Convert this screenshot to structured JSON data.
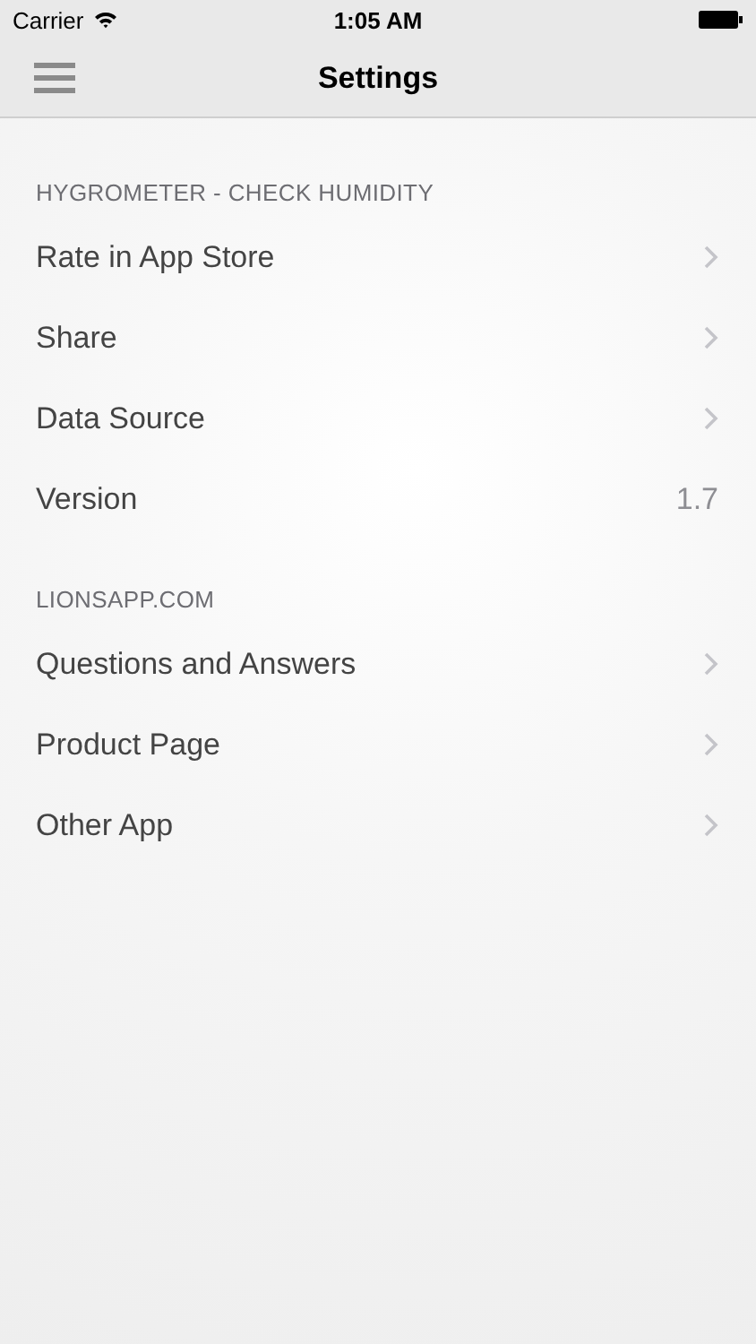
{
  "status_bar": {
    "carrier": "Carrier",
    "time": "1:05 AM"
  },
  "nav_bar": {
    "title": "Settings"
  },
  "sections": [
    {
      "header": "HYGROMETER - CHECK HUMIDITY",
      "rows": [
        {
          "kind": "link",
          "label": "Rate in App Store"
        },
        {
          "kind": "link",
          "label": "Share"
        },
        {
          "kind": "link",
          "label": "Data Source"
        },
        {
          "kind": "value",
          "label": "Version",
          "value": "1.7"
        }
      ]
    },
    {
      "header": "LIONSAPP.COM",
      "rows": [
        {
          "kind": "link",
          "label": "Questions and Answers"
        },
        {
          "kind": "link",
          "label": "Product Page"
        },
        {
          "kind": "link",
          "label": "Other App"
        }
      ]
    }
  ]
}
